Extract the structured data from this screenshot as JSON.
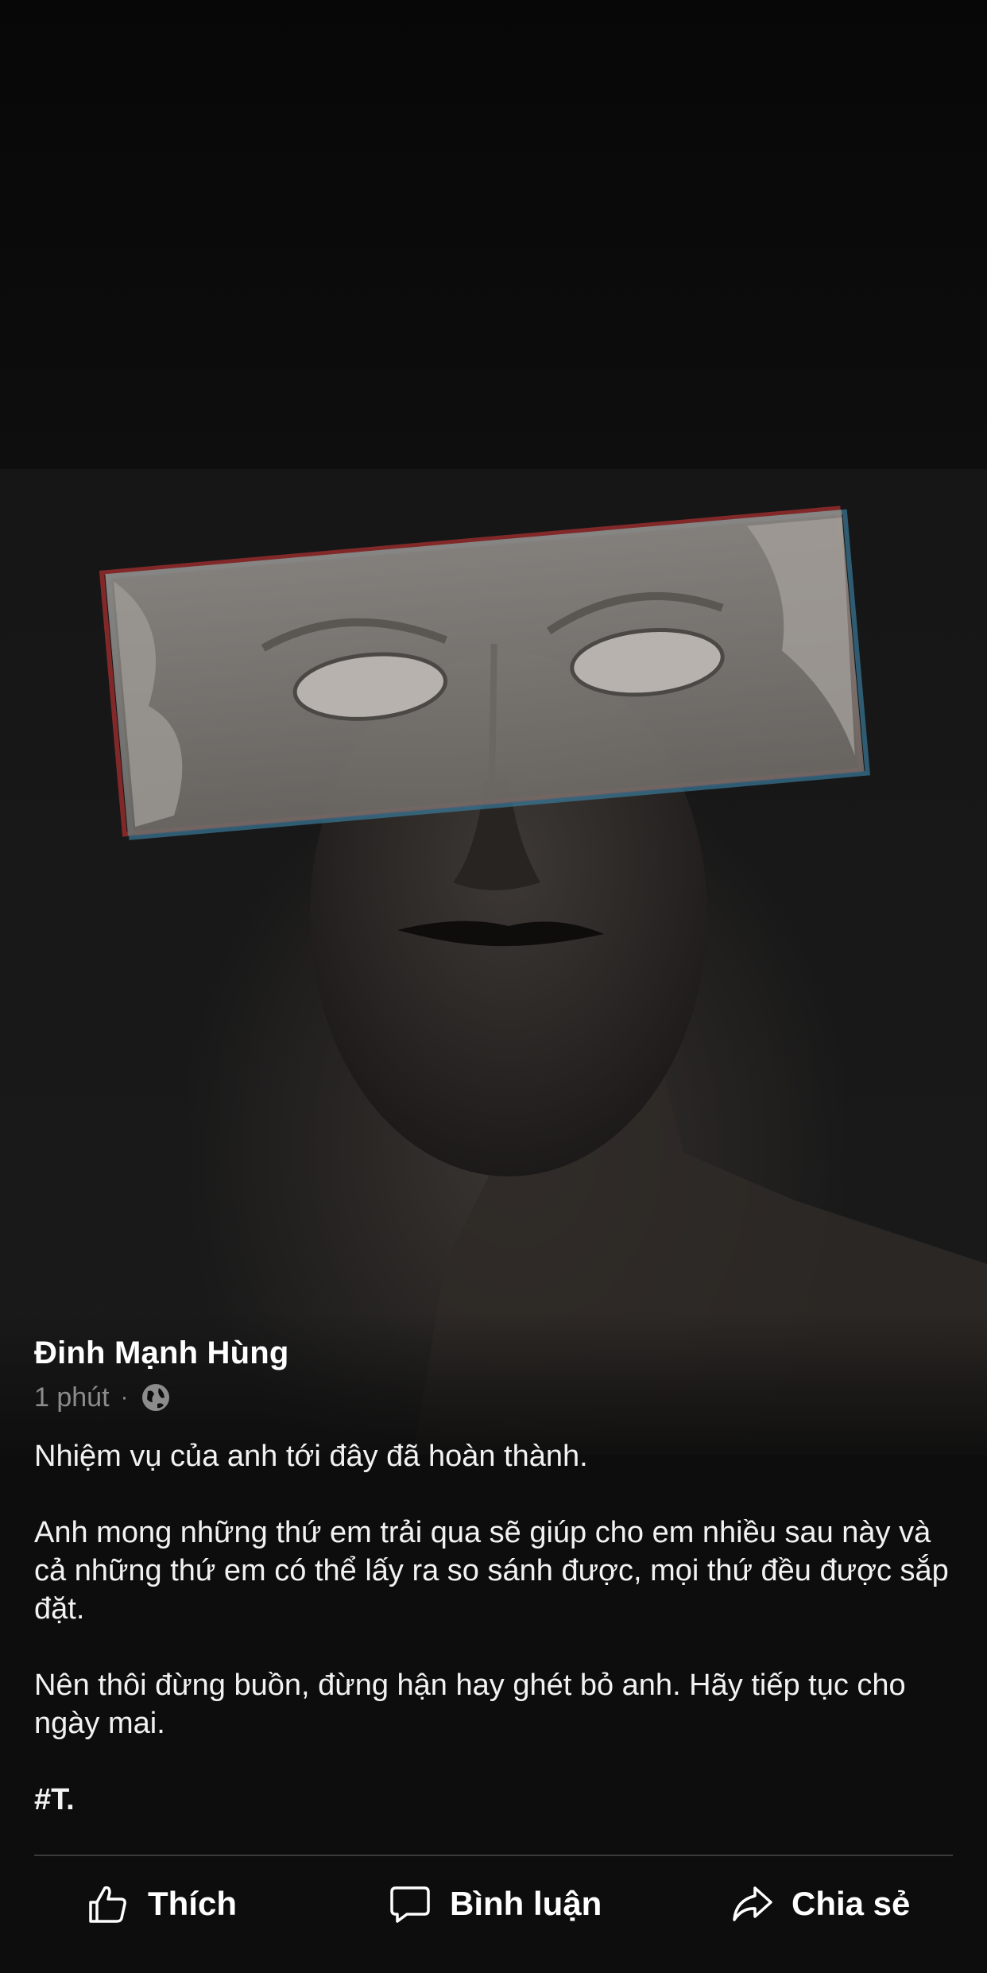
{
  "post": {
    "author": "Đinh Mạnh Hùng",
    "time": "1 phút",
    "separator": "·",
    "privacy_icon": "globe-icon",
    "paragraphs": [
      "Nhiệm vụ của anh tới đây đã hoàn thành.",
      "Anh mong những thứ em trải qua sẽ giúp cho em nhiều sau này và cả những thứ em có thể lấy ra so sánh được, mọi thứ đều được sắp đặt.",
      "Nên thôi đừng buồn, đừng hận hay ghét bỏ anh. Hãy tiếp tục cho ngày mai.",
      "#T."
    ]
  },
  "actions": {
    "like_label": "Thích",
    "like_icon": "thumbs-up-icon",
    "comment_label": "Bình luận",
    "comment_icon": "comment-icon",
    "share_label": "Chia sẻ",
    "share_icon": "share-icon"
  },
  "colors": {
    "background": "#0d0d0d",
    "text": "#ffffff",
    "meta": "#8c8c8c",
    "divider": "#3a3a3a"
  }
}
